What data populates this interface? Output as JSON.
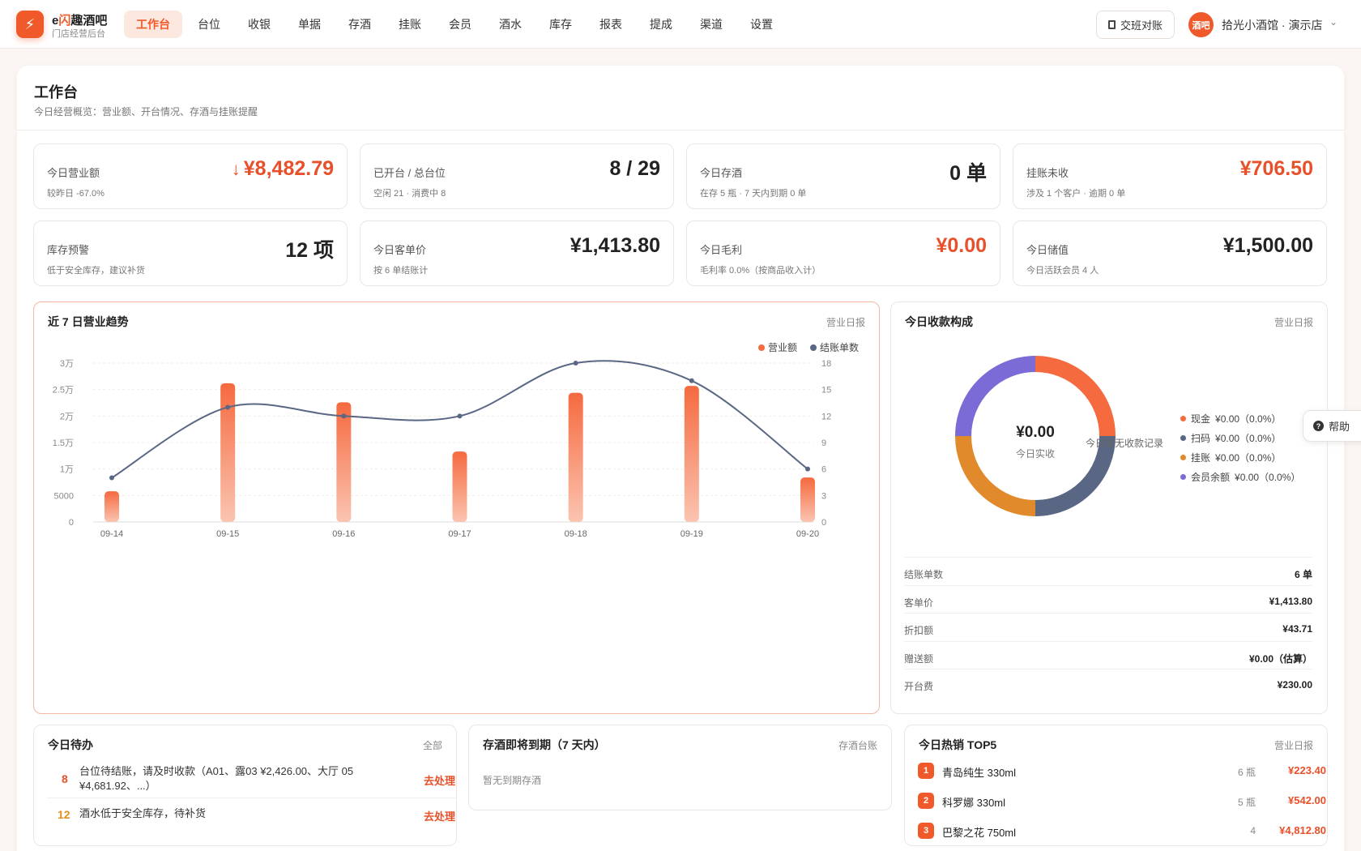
{
  "app": {
    "name_prefix": "e",
    "name_accent": "闪",
    "name_rest": "趣酒吧",
    "subtitle": "门店经营后台"
  },
  "nav": [
    {
      "label": "工作台",
      "active": true
    },
    {
      "label": "台位"
    },
    {
      "label": "收银"
    },
    {
      "label": "单据"
    },
    {
      "label": "存酒"
    },
    {
      "label": "挂账"
    },
    {
      "label": "会员"
    },
    {
      "label": "酒水"
    },
    {
      "label": "库存"
    },
    {
      "label": "报表"
    },
    {
      "label": "提成"
    },
    {
      "label": "渠道"
    },
    {
      "label": "设置"
    }
  ],
  "header": {
    "shift_button": "交班对账",
    "store_avatar": "酒吧",
    "store_name": "拾光小酒馆 · 演示店"
  },
  "page": {
    "title": "工作台",
    "subtitle": "今日经营概览：营业额、开台情况、存酒与挂账提醒"
  },
  "kpis": [
    {
      "label": "今日营业额",
      "sub": "较昨日 -67.0%",
      "value": "¥8,482.79",
      "trend": "down",
      "color": "orange"
    },
    {
      "label": "已开台 / 总台位",
      "sub": "空闲 21 · 消费中 8",
      "value": "8 / 29",
      "color": "dark"
    },
    {
      "label": "今日存酒",
      "sub": "在存 5 瓶 · 7 天内到期 0 单",
      "value": "0 单",
      "color": "dark"
    },
    {
      "label": "挂账未收",
      "sub": "涉及 1 个客户 · 逾期 0 单",
      "value": "¥706.50",
      "color": "orange"
    },
    {
      "label": "库存预警",
      "sub": "低于安全库存，建议补货",
      "value": "12 项",
      "color": "dark"
    },
    {
      "label": "今日客单价",
      "sub": "按 6 单结账计",
      "value": "¥1,413.80",
      "color": "dark"
    },
    {
      "label": "今日毛利",
      "sub": "毛利率 0.0%（按商品收入计）",
      "value": "¥0.00",
      "color": "orange"
    },
    {
      "label": "今日储值",
      "sub": "今日活跃会员 4 人",
      "value": "¥1,500.00",
      "color": "dark"
    }
  ],
  "trend_card": {
    "title": "近 7 日营业趋势",
    "link": "营业日报"
  },
  "chart_data": {
    "type": "bar",
    "categories": [
      "09-14",
      "09-15",
      "09-16",
      "09-17",
      "09-18",
      "09-19",
      "09-20"
    ],
    "series": [
      {
        "name": "营业额",
        "type": "bar",
        "axis": "left",
        "values": [
          5800,
          26200,
          22600,
          13300,
          24400,
          25700,
          8400
        ]
      },
      {
        "name": "结账单数",
        "type": "line",
        "axis": "right",
        "values": [
          5,
          13,
          12,
          12,
          18,
          16,
          6
        ]
      }
    ],
    "ylim_left": [
      0,
      30000
    ],
    "ylim_right": [
      0,
      18
    ],
    "yticks_left": [
      "0",
      "5000",
      "1万",
      "1.5万",
      "2万",
      "2.5万",
      "3万"
    ],
    "yticks_right": [
      "0",
      "3",
      "6",
      "9",
      "12",
      "15",
      "18"
    ],
    "legend": "top-right",
    "colors": {
      "bar": "#f56a3f",
      "line": "#5a6784"
    }
  },
  "payment_card": {
    "title": "今日收款构成",
    "link": "营业日报",
    "center_value": "¥0.00",
    "center_label": "今日实收",
    "empty_text": "今日暂无收款记录",
    "legend": [
      {
        "label": "现金",
        "amount": "¥0.00（0.0%）",
        "color": "#f56a3f"
      },
      {
        "label": "扫码",
        "amount": "¥0.00（0.0%）",
        "color": "#5a6784"
      },
      {
        "label": "挂账",
        "amount": "¥0.00（0.0%）",
        "color": "#e08a2c"
      },
      {
        "label": "会员余额",
        "amount": "¥0.00（0.0%）",
        "color": "#7b6bd6"
      }
    ],
    "stats": [
      {
        "key": "结账单数",
        "value": "6 单"
      },
      {
        "key": "客单价",
        "value": "¥1,413.80"
      },
      {
        "key": "折扣额",
        "value": "¥43.71"
      },
      {
        "key": "赠送额",
        "value": "¥0.00（估算）"
      },
      {
        "key": "开台费",
        "value": "¥230.00"
      }
    ]
  },
  "todo_card": {
    "title": "今日待办",
    "link": "全部",
    "items": [
      {
        "count": "8",
        "text": "台位待结账，请及时收款（A01、露03 ¥2,426.00、大厅 05 ¥4,681.92、...）",
        "action": "去处理",
        "color": "#e8502a"
      },
      {
        "count": "12",
        "text": "酒水低于安全库存，待补货",
        "action": "去处理",
        "color": "#e0901f"
      }
    ]
  },
  "expiry_card": {
    "title": "存酒即将到期（7 天内）",
    "link": "存酒台账",
    "empty": "暂无到期存酒"
  },
  "top_card": {
    "title": "今日热销 TOP5",
    "link": "营业日报",
    "items": [
      {
        "rank": "1",
        "name": "青岛纯生 330ml",
        "qty": "6 瓶",
        "amount": "¥223.40"
      },
      {
        "rank": "2",
        "name": "科罗娜 330ml",
        "qty": "5 瓶",
        "amount": "¥542.00"
      },
      {
        "rank": "3",
        "name": "巴黎之花 750ml",
        "qty": "4",
        "amount": "¥4,812.80"
      }
    ]
  },
  "help": {
    "label": "帮助"
  }
}
